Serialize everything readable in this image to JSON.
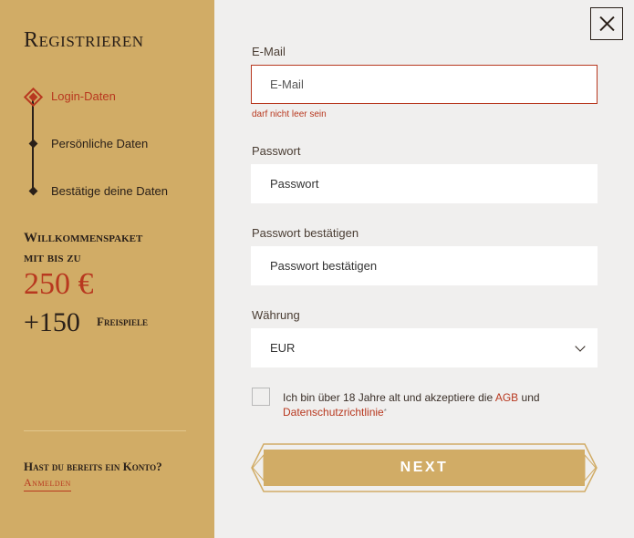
{
  "sidebar": {
    "title": "Registrieren",
    "steps": [
      {
        "label": "Login-Daten"
      },
      {
        "label": "Persönliche Daten"
      },
      {
        "label": "Bestätige deine Daten"
      }
    ],
    "promo": {
      "line1": "Willkommenspaket",
      "line2": "mit bis zu",
      "amount": "250 €",
      "spins": "+150",
      "spins_label": "Freispiele"
    },
    "account_question": "Hast du bereits ein Konto?",
    "login_link": "Anmelden"
  },
  "form": {
    "email": {
      "label": "E-Mail",
      "placeholder": "E-Mail",
      "error": "darf nicht leer sein"
    },
    "password": {
      "label": "Passwort",
      "placeholder": "Passwort"
    },
    "password_confirm": {
      "label": "Passwort bestätigen",
      "placeholder": "Passwort bestätigen"
    },
    "currency": {
      "label": "Währung",
      "value": "EUR"
    },
    "terms": {
      "text_before": "Ich bin über 18 Jahre alt und akzeptiere die",
      "agb": "AGB",
      "and": "und",
      "privacy": "Datenschutzrichtlinie",
      "required_mark": "*"
    },
    "next_label": "NEXT"
  },
  "colors": {
    "sidebar_bg": "#d1ac66",
    "accent_red": "#b8381f",
    "button_gold": "#d1ac66",
    "main_bg": "#f0efee"
  },
  "icons": {
    "close": "close-icon",
    "chevron": "chevron-down-icon"
  }
}
